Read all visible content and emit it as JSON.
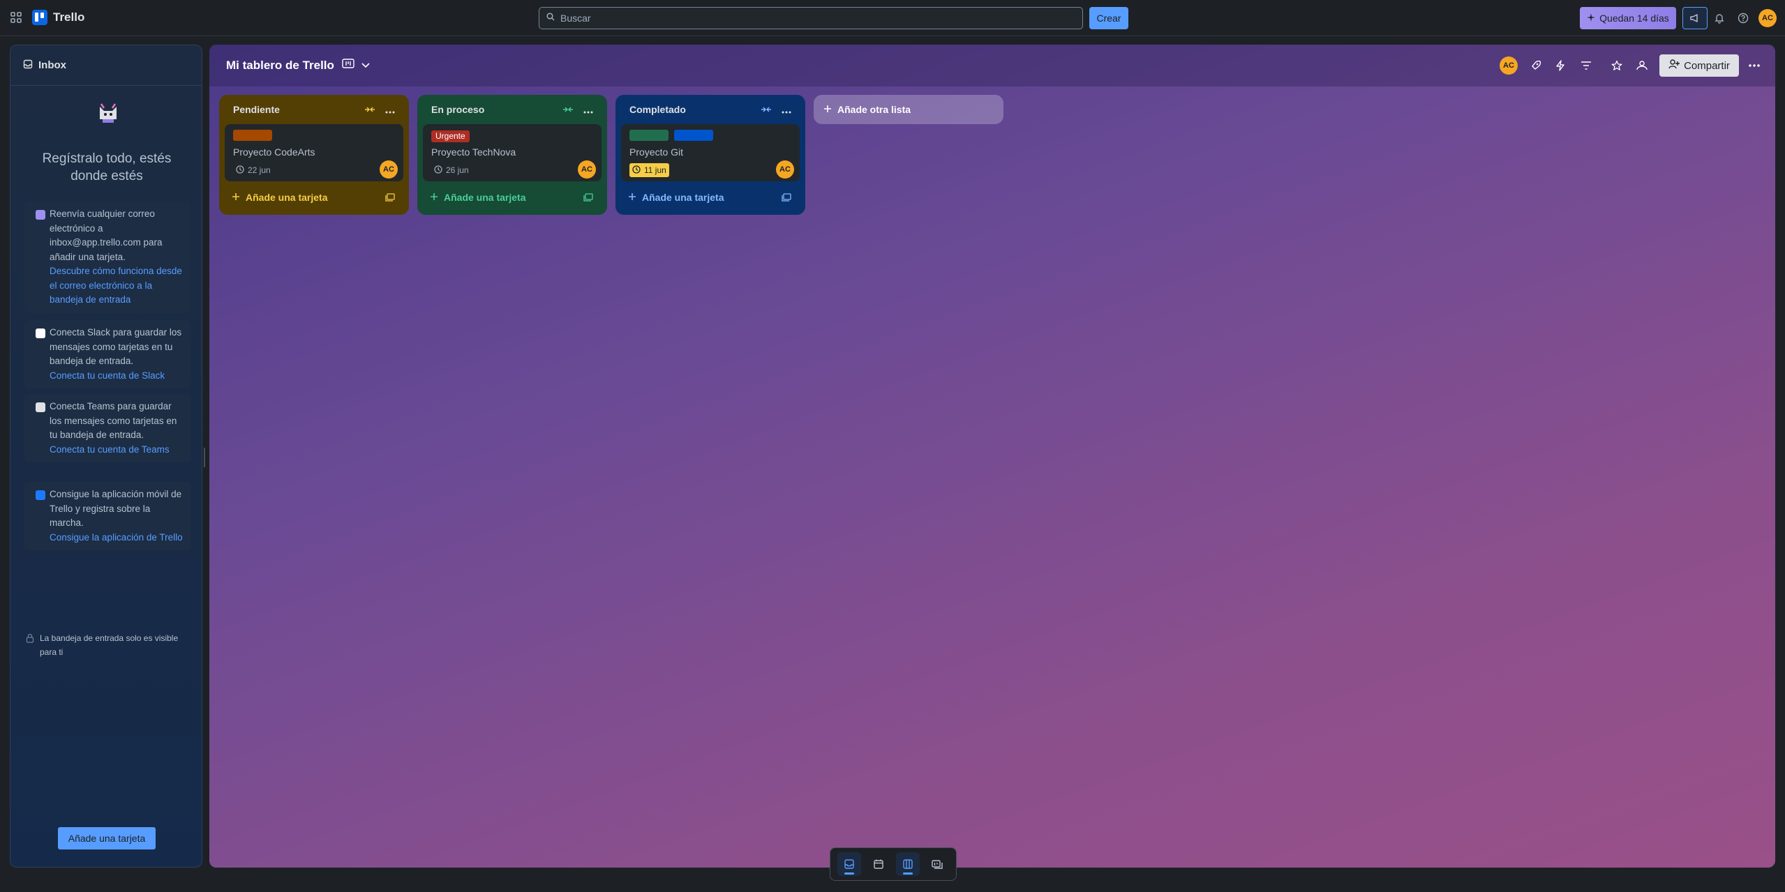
{
  "topbar": {
    "app_name": "Trello",
    "search_placeholder": "Buscar",
    "create_label": "Crear",
    "trial_label": "Quedan 14 días",
    "user_initials": "AC"
  },
  "inbox": {
    "title": "Inbox",
    "headline": "Regístralo todo, estés donde estés",
    "tips": [
      {
        "text": "Reenvía cualquier correo electrónico a inbox@app.trello.com para añadir una tarjeta.",
        "link": "Descubre cómo funciona desde el correo electrónico a la bandeja de entrada"
      },
      {
        "text": "Conecta Slack para guardar los mensajes como tarjetas en tu bandeja de entrada.",
        "link": "Conecta tu cuenta de Slack"
      },
      {
        "text": "Conecta Teams para guardar los mensajes como tarjetas en tu bandeja de entrada.",
        "link": "Conecta tu cuenta de Teams"
      },
      {
        "text": "Consigue la aplicación móvil de Trello y registra sobre la marcha.",
        "link": "Consigue la aplicación de Trello"
      }
    ],
    "visibility_note": "La bandeja de entrada solo es visible para ti",
    "add_card_label": "Añade una tarjeta"
  },
  "board": {
    "title": "Mi tablero de Trello",
    "share_label": "Compartir",
    "member_initials": "AC",
    "add_list_label": "Añade otra lista",
    "lists": [
      {
        "name": "Pendiente",
        "add_card_label": "Añade una tarjeta",
        "cards": [
          {
            "title": "Proyecto CodeArts",
            "date": "22 jun",
            "member": "AC"
          }
        ]
      },
      {
        "name": "En proceso",
        "add_card_label": "Añade una tarjeta",
        "cards": [
          {
            "title": "Proyecto TechNova",
            "label": "Urgente",
            "date": "26 jun",
            "member": "AC"
          }
        ]
      },
      {
        "name": "Completado",
        "add_card_label": "Añade una tarjeta",
        "cards": [
          {
            "title": "Proyecto Git",
            "date": "11 jun",
            "member": "AC"
          }
        ]
      }
    ]
  },
  "colors": {
    "accent": "#579dff",
    "list_pendiente": "#533f04",
    "list_en_proceso": "#164b35",
    "list_completado": "#09326c",
    "label_orange": "#a54800",
    "label_red": "#ae2e24",
    "label_green": "#216e4e",
    "label_blue": "#0055cc",
    "due_yellow": "#f5cd47"
  }
}
